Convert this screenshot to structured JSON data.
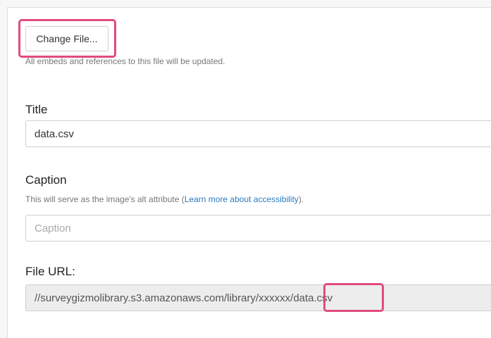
{
  "file": {
    "change_button_label": "Change File...",
    "hint": "All embeds and references to this file will be updated."
  },
  "title": {
    "label": "Title",
    "value": "data.csv"
  },
  "caption": {
    "label": "Caption",
    "hint_prefix": "This will serve as the image's alt attribute (",
    "hint_link": "Learn more about accessibility",
    "hint_suffix": ").",
    "placeholder": "Caption"
  },
  "file_url": {
    "label": "File URL:",
    "value": "//surveygizmolibrary.s3.amazonaws.com/library/xxxxxx/data.csv"
  },
  "colors": {
    "highlight": "#e24b7d",
    "link": "#2a7bbf",
    "readonly_bg": "#ededed"
  }
}
